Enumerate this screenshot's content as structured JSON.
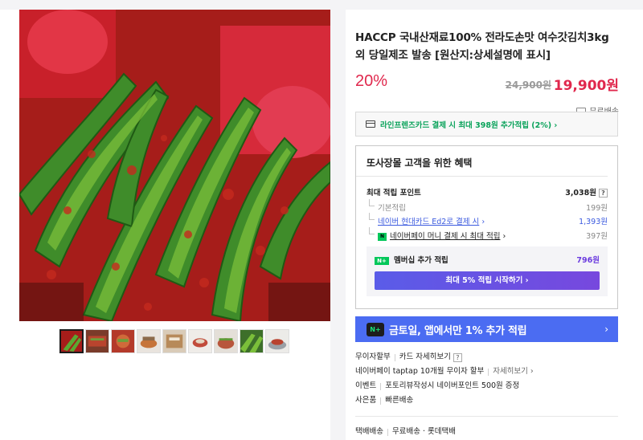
{
  "product": {
    "title": "HACCP 국내산재료100% 전라도손맛 여수갓김치3kg 외 당일제조 발송 [원산지:상세설명에 표시]",
    "discount": "20%",
    "original_price": "24,900원",
    "sale_price": "19,900원",
    "shipping": "무료배송"
  },
  "card_banner": {
    "text": "라인프렌즈카드 결제 시 최대 398원 추가적립 (2%) ›"
  },
  "benefits": {
    "title": "또사장몰 고객을 위한 혜택",
    "max_points_label": "최대 적립 포인트",
    "max_points_value": "3,038원",
    "help": "?",
    "rows": [
      {
        "label": "기본적립",
        "value": "199원"
      },
      {
        "label": "네이버 현대카드 Ed2로 결제 시",
        "value": "1,393원"
      },
      {
        "label": "네이버페이 머니 결제 시 최대 적립",
        "value": "397원"
      }
    ],
    "np_badge": "N",
    "membership": {
      "badge": "N+",
      "label": "멤버십 추가 적립",
      "value": "796원",
      "button": "최대 5% 적립 시작하기 ›"
    }
  },
  "promo": {
    "icon": "N+",
    "text": "금토일, 앱에서만 1% 추가 적립",
    "arrow": "›"
  },
  "info": {
    "installment_label": "무이자할부",
    "installment_link": "카드 자세히보기",
    "taptap_text": "네이버페이 taptap 10개월 무이자 할부",
    "taptap_link": "자세히보기 ›",
    "event_label": "이벤트",
    "event_text": "포토리뷰작성시 네이버포인트 500원 증정",
    "gift_label": "사은품",
    "gift_text": "빠른배송",
    "delivery_label": "택배배송",
    "delivery_text": "무료배송 · 롯데택배"
  },
  "colors": {
    "accent_red": "#e0284d",
    "naver_green": "#03c75a",
    "promo_blue": "#4b6cf2",
    "member_purple": "#7748de"
  }
}
